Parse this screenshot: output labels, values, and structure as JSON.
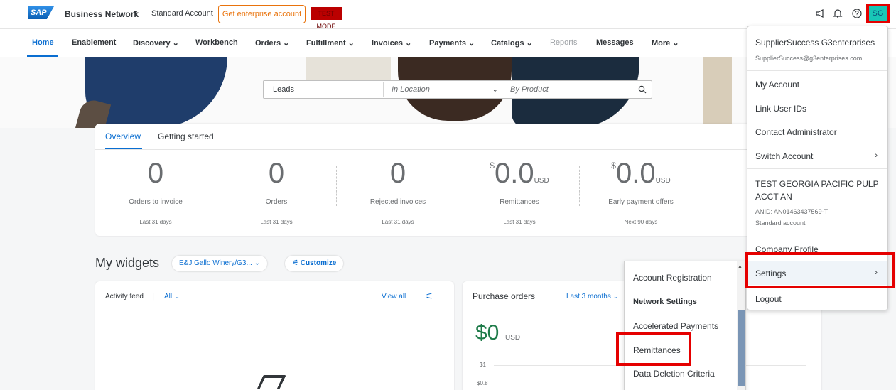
{
  "header": {
    "logo": "SAP",
    "product": "Business Network",
    "account_type": "Standard Account",
    "enterprise_button": "Get enterprise account",
    "test_mode": "TEST MODE",
    "avatar_initials": "SG"
  },
  "nav": {
    "items": [
      {
        "label": "Home"
      },
      {
        "label": "Enablement"
      },
      {
        "label": "Discovery ⌄"
      },
      {
        "label": "Workbench"
      },
      {
        "label": "Orders ⌄"
      },
      {
        "label": "Fulfillment ⌄"
      },
      {
        "label": "Invoices ⌄"
      },
      {
        "label": "Payments ⌄"
      },
      {
        "label": "Catalogs ⌄"
      },
      {
        "label": "Reports"
      },
      {
        "label": "Messages"
      },
      {
        "label": "More ⌄"
      }
    ]
  },
  "search": {
    "keyword": "Leads",
    "location_placeholder": "In Location",
    "product_placeholder": "By Product"
  },
  "overview": {
    "tabs": [
      {
        "label": "Overview"
      },
      {
        "label": "Getting started"
      }
    ],
    "tiles": [
      {
        "value": "0",
        "label": "Orders to invoice",
        "period": "Last 31 days"
      },
      {
        "value": "0",
        "label": "Orders",
        "period": "Last 31 days"
      },
      {
        "value": "0",
        "label": "Rejected invoices",
        "period": "Last 31 days"
      },
      {
        "currency": "$",
        "value": "0.0",
        "unit": "USD",
        "label": "Remittances",
        "period": "Last 31 days"
      },
      {
        "currency": "$",
        "value": "0.0",
        "unit": "USD",
        "label": "Early payment offers",
        "period": "Next 90 days"
      }
    ]
  },
  "widgets": {
    "title": "My widgets",
    "customer_filter": "E&J Gallo Winery/G3... ⌄",
    "customize": "Customize",
    "activity_feed": {
      "title": "Activity feed",
      "filter": "All ⌄",
      "view_all": "View all"
    },
    "purchase_orders": {
      "title": "Purchase orders",
      "range": "Last 3 months ⌄",
      "amount": "$0",
      "unit": "USD",
      "ticks": [
        "$1",
        "$0.8"
      ]
    }
  },
  "user_menu": {
    "name": "SupplierSuccess G3enterprises",
    "email": "SupplierSuccess@g3enterprises.com",
    "items": [
      "My Account",
      "Link User IDs",
      "Contact Administrator",
      "Switch Account"
    ],
    "company_name": "TEST GEORGIA PACIFIC PULP ACCT AN",
    "anid": "ANID: AN01463437569-T",
    "account_type": "Standard account",
    "company_profile": "Company Profile",
    "settings": "Settings",
    "logout": "Logout"
  },
  "settings_menu": {
    "items": [
      "Account Registration",
      "Network Settings",
      "Accelerated Payments",
      "Remittances",
      "Data Deletion Criteria"
    ]
  },
  "colors": {
    "accent": "#0a6ed1",
    "highlight_box": "#e50000",
    "avatar": "#18c6b6",
    "enterprise": "#e9730c"
  }
}
